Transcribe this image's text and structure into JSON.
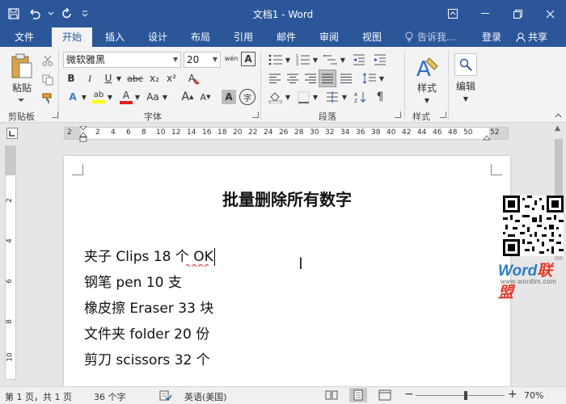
{
  "window": {
    "title": "文档1 - Word"
  },
  "tabs": [
    {
      "label": "文件"
    },
    {
      "label": "开始"
    },
    {
      "label": "插入"
    },
    {
      "label": "设计"
    },
    {
      "label": "布局"
    },
    {
      "label": "引用"
    },
    {
      "label": "邮件"
    },
    {
      "label": "审阅"
    },
    {
      "label": "视图"
    }
  ],
  "tell_me": "告诉我...",
  "sign_in": "登录",
  "share": "共享",
  "ribbon": {
    "paste_label": "粘贴",
    "font_name": "微软雅黑",
    "font_size": "20",
    "styles_label": "样式",
    "editing_label": "编辑",
    "groups": {
      "clipboard": "剪贴板",
      "font": "字体",
      "paragraph": "段落",
      "styles": "样式"
    },
    "bold": "B",
    "italic": "I",
    "underline": "U",
    "strike": "abc",
    "subscript": "x₂",
    "superscript": "x²",
    "clear_format": "A",
    "grow_font": "A",
    "shrink_font": "A",
    "char_shade": "A",
    "enclose": "字",
    "phonetic": "wén",
    "char_border": "A",
    "highlight": "ab",
    "font_color": "A",
    "text_effect": "A",
    "case": "Aa"
  },
  "ruler": {
    "numbers": [
      "2",
      "2",
      "4",
      "6",
      "8",
      "10",
      "12",
      "14",
      "16",
      "18",
      "20",
      "22",
      "24",
      "26",
      "28",
      "30",
      "32",
      "34",
      "36",
      "38",
      "40",
      "42",
      "44",
      "46",
      "48",
      "50",
      "52"
    ]
  },
  "vruler": {
    "numbers": [
      "2",
      "4",
      "6",
      "8",
      "10",
      "12"
    ]
  },
  "document": {
    "heading": "批量删除所有数字",
    "lines": [
      "夹子 Clips 18 个 OK",
      "钢笔 pen 10 支",
      "橡皮擦 Eraser 33 块",
      "文件夹 folder 20 份",
      "剪刀 scissors 32 个"
    ]
  },
  "watermark": {
    "brand_a": "Word",
    "brand_b": "联盟",
    "url": "www.wordlm.com"
  },
  "status": {
    "page": "第 1 页，共 1 页",
    "words": "36 个字",
    "language": "英语(美国)",
    "zoom": "70%",
    "zoom_minus": "−",
    "zoom_plus": "+"
  },
  "colors": {
    "word_blue": "#2b579a",
    "highlight_yellow": "#ffff00",
    "font_red": "#e02020"
  }
}
